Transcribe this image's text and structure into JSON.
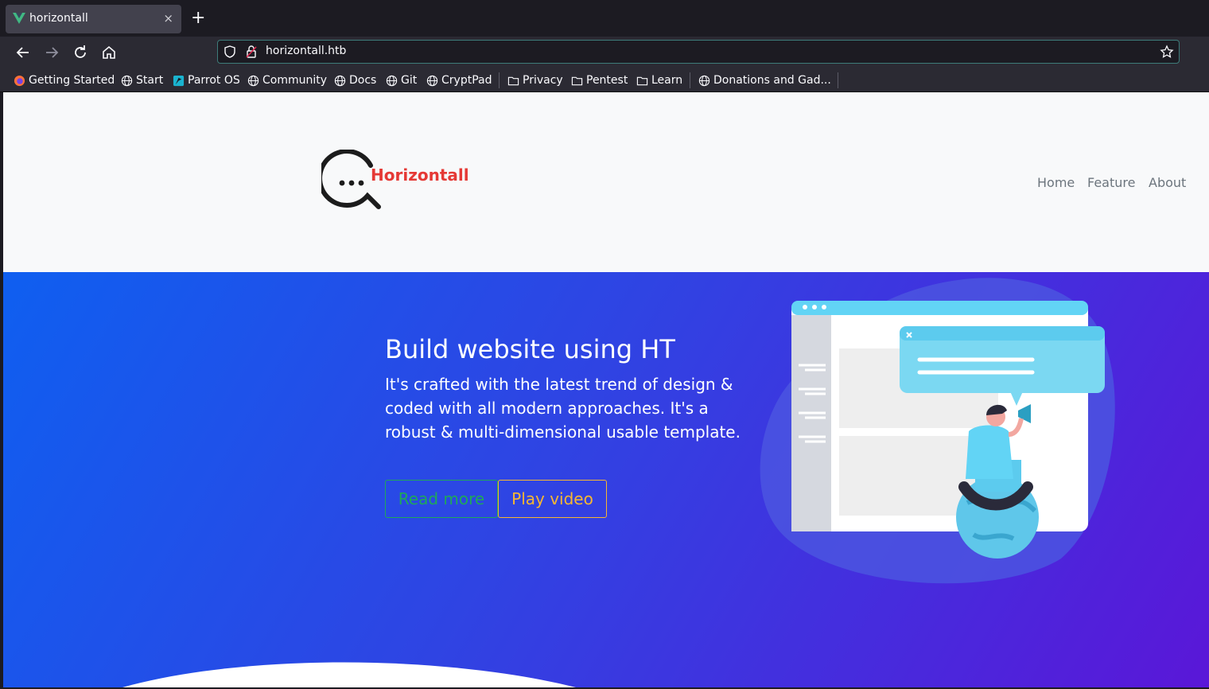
{
  "browser": {
    "tab_title": "horizontall",
    "tab_close": "×",
    "new_tab": "+",
    "url": "horizontall.htb"
  },
  "bookmarks": [
    {
      "label": "Getting Started",
      "icon": "firefox-icon"
    },
    {
      "label": "Start",
      "icon": "globe-icon"
    },
    {
      "label": "Parrot OS",
      "icon": "parrot-icon"
    },
    {
      "label": "Community",
      "icon": "globe-icon"
    },
    {
      "label": "Docs",
      "icon": "globe-icon"
    },
    {
      "label": "Git",
      "icon": "globe-icon"
    },
    {
      "label": "CryptPad",
      "icon": "globe-icon"
    },
    {
      "label": "Privacy",
      "icon": "folder-icon"
    },
    {
      "label": "Pentest",
      "icon": "folder-icon"
    },
    {
      "label": "Learn",
      "icon": "folder-icon"
    },
    {
      "label": "Donations and Gad...",
      "icon": "globe-icon"
    }
  ],
  "site": {
    "logo_text": "Horizontall",
    "nav": [
      "Home",
      "Feature",
      "About"
    ],
    "hero": {
      "title": "Build website using HT",
      "body": "It's crafted with the latest trend of design & coded with all modern approaches. It's a robust & multi-dimensional usable template.",
      "read_more": "Read more",
      "play_video": "Play video"
    }
  },
  "colors": {
    "brand": "#e53935",
    "hero_start": "#0f5ff0",
    "hero_end": "#5a17d8",
    "read_more": "#1fa85a",
    "play_video": "#f7b731"
  }
}
